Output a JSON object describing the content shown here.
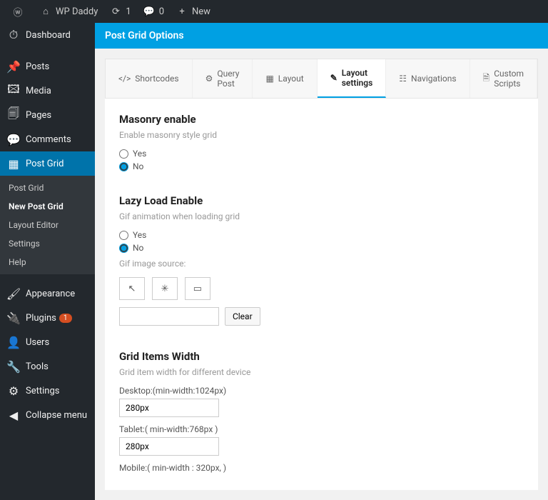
{
  "toolbar": {
    "site_name": "WP Daddy",
    "updates_count": "1",
    "comments_count": "0",
    "new_label": "New"
  },
  "sidebar": {
    "items": [
      {
        "label": "Dashboard"
      },
      {
        "label": "Posts"
      },
      {
        "label": "Media"
      },
      {
        "label": "Pages"
      },
      {
        "label": "Comments"
      },
      {
        "label": "Post Grid"
      },
      {
        "label": "Appearance"
      },
      {
        "label": "Plugins",
        "badge": "1"
      },
      {
        "label": "Users"
      },
      {
        "label": "Tools"
      },
      {
        "label": "Settings"
      },
      {
        "label": "Collapse menu"
      }
    ],
    "submenu": [
      {
        "label": "Post Grid"
      },
      {
        "label": "New Post Grid"
      },
      {
        "label": "Layout Editor"
      },
      {
        "label": "Settings"
      },
      {
        "label": "Help"
      }
    ]
  },
  "page": {
    "title": "Post Grid Options"
  },
  "tabs": [
    {
      "label": "Shortcodes"
    },
    {
      "label": "Query Post"
    },
    {
      "label": "Layout"
    },
    {
      "label": "Layout settings"
    },
    {
      "label": "Navigations"
    },
    {
      "label": "Custom Scripts"
    }
  ],
  "sections": {
    "masonry": {
      "title": "Masonry enable",
      "desc": "Enable masonry style grid",
      "yes": "Yes",
      "no": "No"
    },
    "lazy": {
      "title": "Lazy Load Enable",
      "desc": "Gif animation when loading grid",
      "yes": "Yes",
      "no": "No",
      "source_label": "Gif image source:",
      "clear": "Clear"
    },
    "width": {
      "title": "Grid Items Width",
      "desc": "Grid item width for different device",
      "desktop_label": "Desktop:(min-width:1024px)",
      "desktop_value": "280px",
      "tablet_label": "Tablet:( min-width:768px )",
      "tablet_value": "280px",
      "mobile_label": "Mobile:( min-width : 320px, )"
    }
  }
}
